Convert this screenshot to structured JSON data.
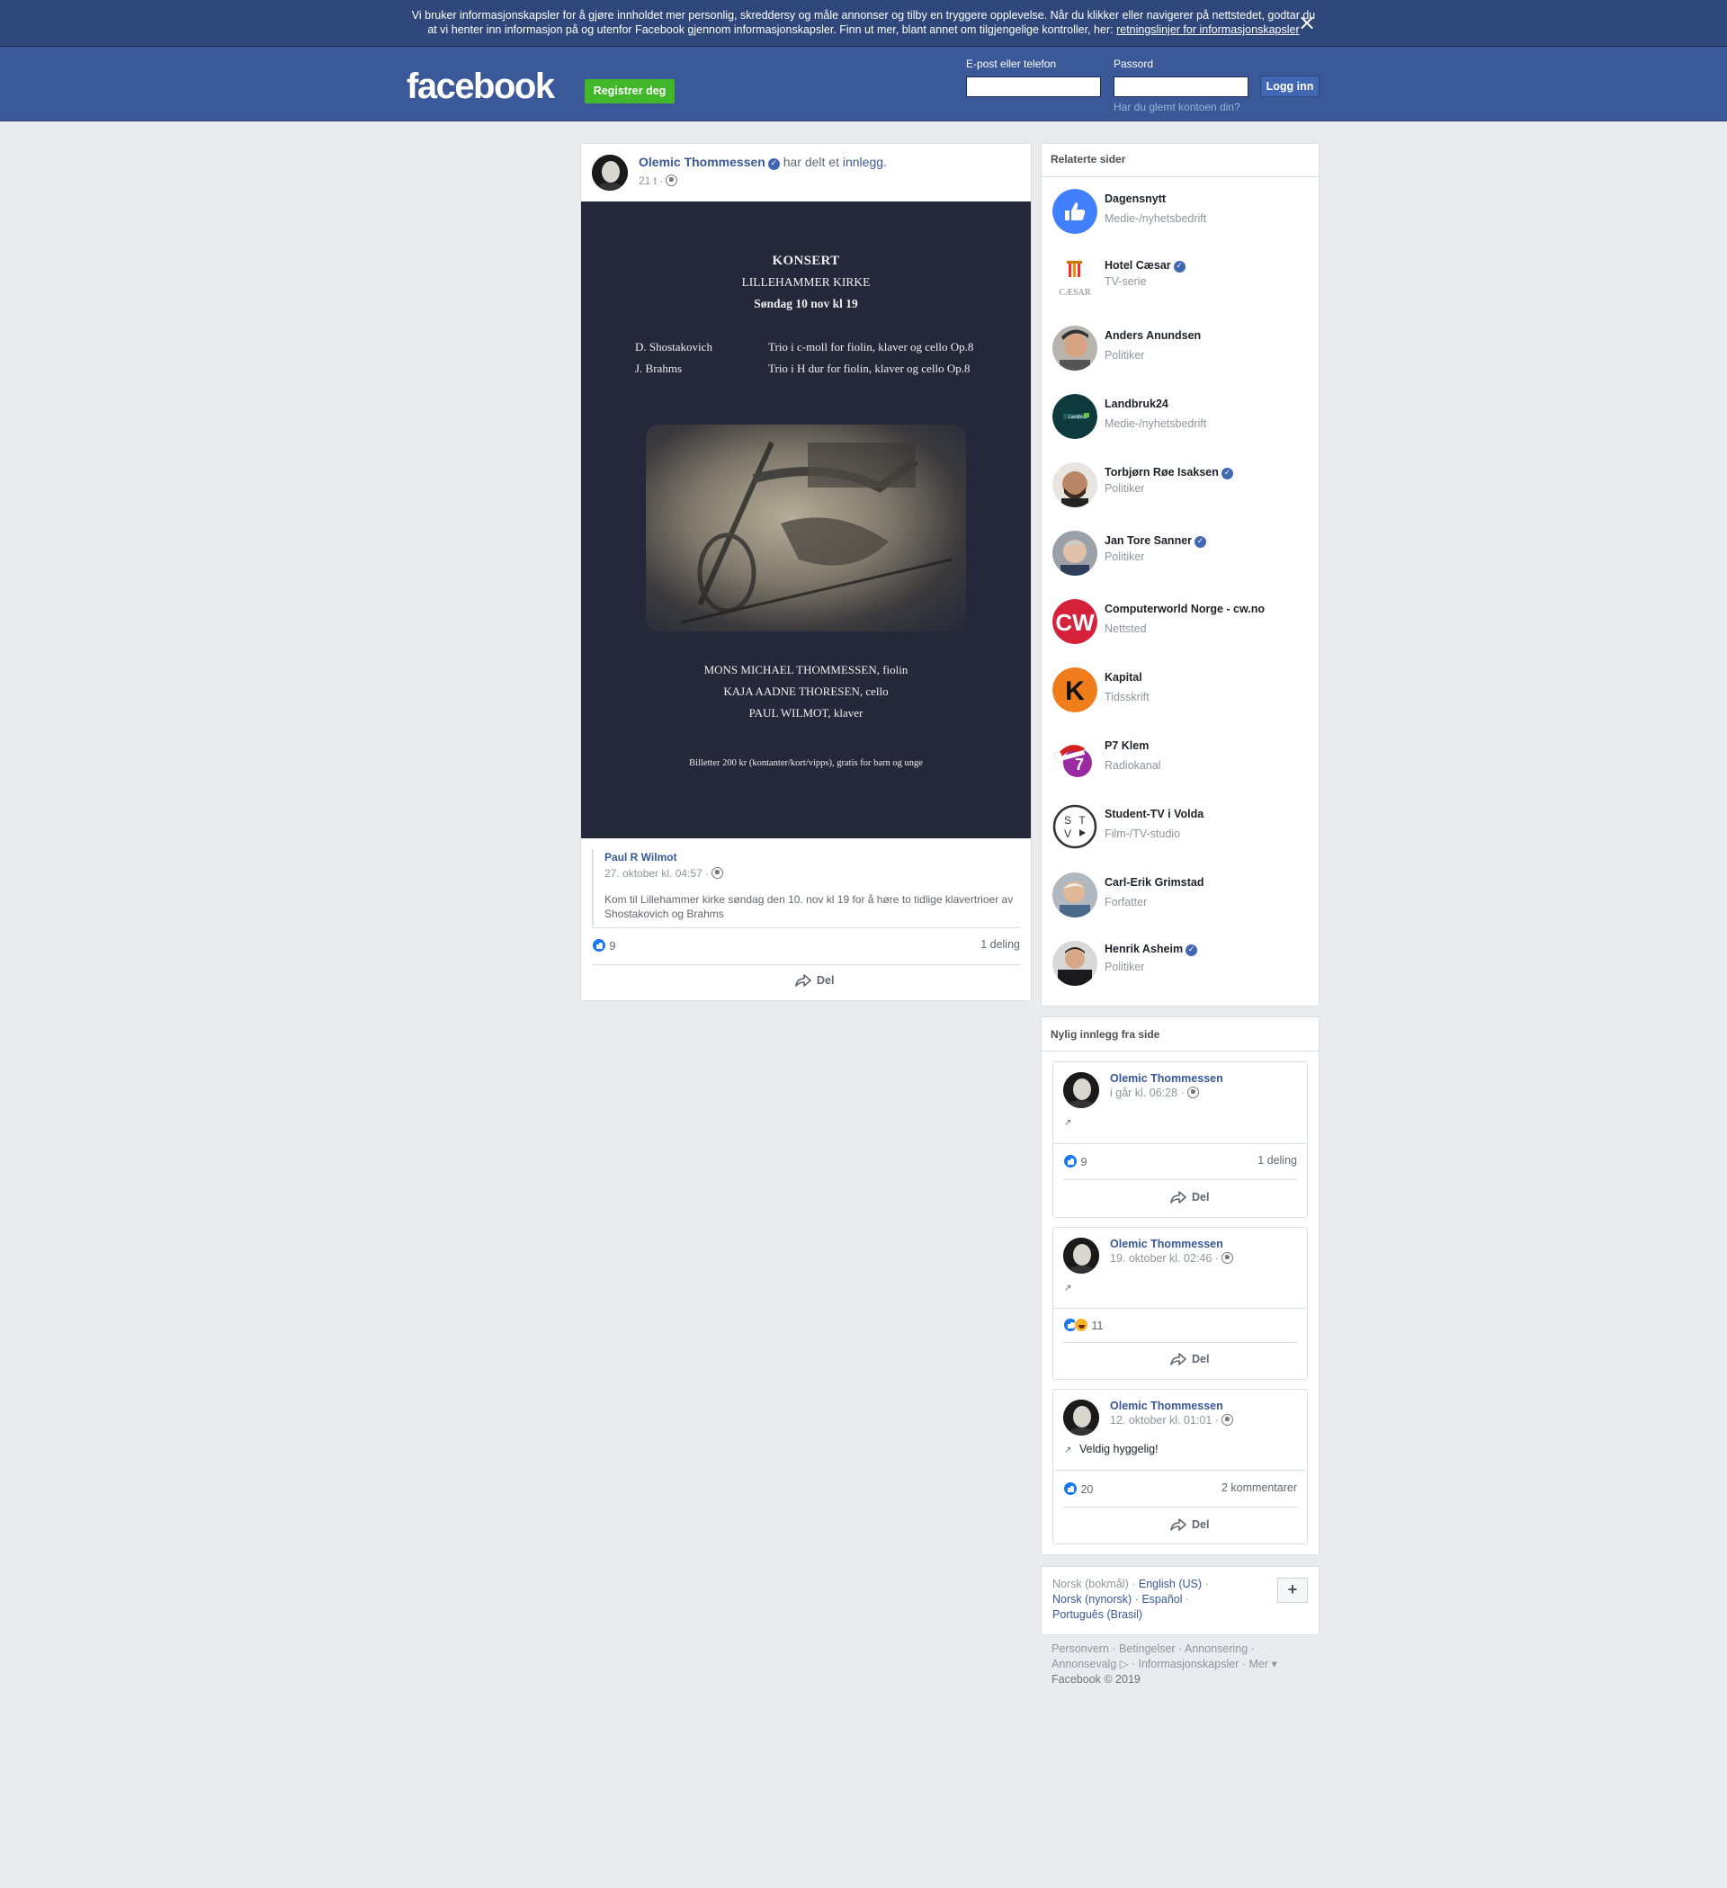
{
  "cookie": {
    "text": "Vi bruker informasjonskapsler for å gjøre innholdet mer personlig, skreddersy og måle annonser og tilby en tryggere opplevelse. Når du klikker eller navigerer på nettstedet, godtar du at vi henter inn informasjon på og utenfor Facebook gjennom informasjonskapsler. Finn ut mer, blant annet om tilgjengelige kontroller, her: ",
    "link": "retningslinjer for informasjonskapsler",
    "close_icon": "×"
  },
  "header": {
    "logo": "facebook",
    "register": "Registrer deg",
    "email_label": "E-post eller telefon",
    "password_label": "Passord",
    "login": "Logg inn",
    "forgot": "Har du glemt kontoen din?"
  },
  "post": {
    "author": "Olemic Thommessen",
    "shared_text": "har delt et",
    "shared_link": "innlegg.",
    "time": "21 t ·",
    "poster": {
      "title": "KONSERT",
      "venue": "LILLEHAMMER KIRKE",
      "date": "Søndag 10 nov kl 19",
      "composers": [
        "D. Shostakovich",
        "J. Brahms"
      ],
      "works": [
        "Trio i c-moll for fiolin, klaver og cello Op.8",
        "Trio i H dur for fiolin, klaver og cello Op.8"
      ],
      "performers": [
        "MONS MICHAEL THOMMESSEN, fiolin",
        "KAJA AADNE THORESEN, cello",
        "PAUL WILMOT, klaver"
      ],
      "tickets": "Billetter 200 kr (kontanter/kort/vipps), gratis for barn og unge"
    },
    "quote": {
      "name": "Paul R Wilmot",
      "time": "27. oktober kl. 04:57 ·",
      "text": "Kom til Lillehammer kirke søndag den 10. nov kl 19 for å høre to tidlige klavertrioer av Shostakovich og Brahms"
    },
    "likes": "9",
    "shares": "1 deling",
    "share_label": "Del"
  },
  "related": {
    "title": "Relaterte sider",
    "items": [
      {
        "name": "Dagensnytt",
        "category": "Medie-/nyhetsbedrift",
        "verified": false,
        "color": "#4080ff"
      },
      {
        "name": "Hotel Cæsar",
        "category": "TV-serie",
        "verified": true,
        "color": "#ffffff"
      },
      {
        "name": "Anders Anundsen",
        "category": "Politiker",
        "verified": false,
        "color": "#6b5a4a"
      },
      {
        "name": "Landbruk24",
        "category": "Medie-/nyhetsbedrift",
        "verified": false,
        "color": "#0e3a3e"
      },
      {
        "name": "Torbjørn Røe Isaksen",
        "category": "Politiker",
        "verified": true,
        "color": "#5a4a3c"
      },
      {
        "name": "Jan Tore Sanner",
        "category": "Politiker",
        "verified": true,
        "color": "#7a7a80"
      },
      {
        "name": "Computerworld Norge - cw.no",
        "category": "Nettsted",
        "verified": false,
        "color": "#d6213b"
      },
      {
        "name": "Kapital",
        "category": "Tidsskrift",
        "verified": false,
        "color": "#f07d1c"
      },
      {
        "name": "P7 Klem",
        "category": "Radiokanal",
        "verified": false,
        "color": "#9a2aa0"
      },
      {
        "name": "Student-TV i Volda",
        "category": "Film-/TV-studio",
        "verified": false,
        "color": "#ffffff"
      },
      {
        "name": "Carl-Erik Grimstad",
        "category": "Forfatter",
        "verified": false,
        "color": "#6e7a8a"
      },
      {
        "name": "Henrik Asheim",
        "category": "Politiker",
        "verified": true,
        "color": "#2a2a2e"
      }
    ]
  },
  "recent": {
    "title": "Nylig innlegg fra side",
    "posts": [
      {
        "name": "Olemic Thommessen",
        "time": "i går kl. 06:28 ·",
        "text": "",
        "likes": "9",
        "right": "1 deling",
        "share": "Del"
      },
      {
        "name": "Olemic Thommessen",
        "time": "19. oktober kl. 02:46 ·",
        "text": "",
        "likes": "11",
        "right": "",
        "share": "Del"
      },
      {
        "name": "Olemic Thommessen",
        "time": "12. oktober kl. 01:01 ·",
        "text": "Veldig hyggelig!",
        "likes": "20",
        "right": "2 kommentarer",
        "share": "Del"
      }
    ]
  },
  "footer": {
    "lang_current": "Norsk (bokmål) ·",
    "lang_en": "English (US)",
    "lang_nn": "Norsk (nynorsk)",
    "lang_es": "Español",
    "lang_pt": "Português (Brasil)",
    "sep": " · ",
    "plus": "+",
    "links": [
      "Personvern",
      "Betingelser",
      "Annonsering",
      "Annonsevalg",
      "Informasjonskapsler",
      "Mer"
    ],
    "copyright": "Facebook © 2019"
  }
}
